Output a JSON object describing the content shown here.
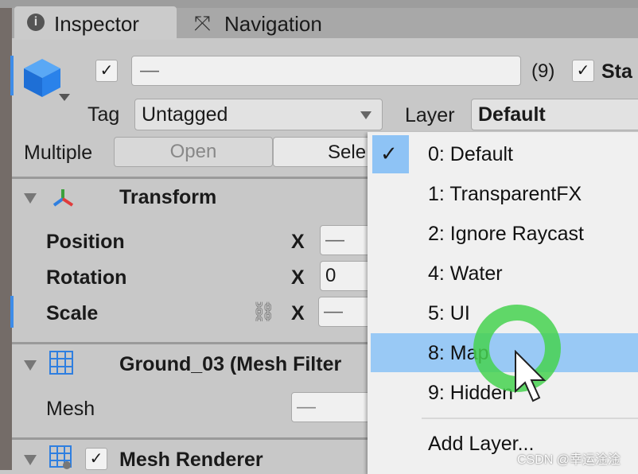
{
  "tabs": [
    {
      "label": "Inspector",
      "icon": "info-icon",
      "active": true
    },
    {
      "label": "Navigation",
      "icon": "navigation-icon",
      "active": false
    }
  ],
  "object": {
    "active": true,
    "name": "—",
    "count": "(9)",
    "static_checked": true,
    "static_label": "Sta",
    "tag_label": "Tag",
    "tag_value": "Untagged",
    "layer_label": "Layer",
    "layer_value": "Default",
    "multiple_label": "Multiple",
    "open_label": "Open",
    "select_label": "Sele"
  },
  "transform": {
    "title": "Transform",
    "rows": [
      {
        "label": "Position",
        "axis": "X",
        "value": "—"
      },
      {
        "label": "Rotation",
        "axis": "X",
        "value": "0"
      },
      {
        "label": "Scale",
        "axis": "X",
        "value": "—"
      }
    ]
  },
  "mesh_filter": {
    "title": "Ground_03 (Mesh Filter",
    "mesh_label": "Mesh",
    "mesh_value": "—"
  },
  "mesh_renderer": {
    "title": "Mesh Renderer",
    "enabled": true
  },
  "layer_menu": {
    "items": [
      "0: Default",
      "1: TransparentFX",
      "2: Ignore Raycast",
      "4: Water",
      "5: UI",
      "8: Map",
      "9: Hidden"
    ],
    "checked": "0: Default",
    "hovered": "8: Map",
    "add_label": "Add Layer..."
  },
  "watermark": "CSDN @幸运淦淦",
  "colors": {
    "highlight": "#99c9f5",
    "click_ring": "#4fd65a",
    "accent": "#2f7fe0"
  }
}
